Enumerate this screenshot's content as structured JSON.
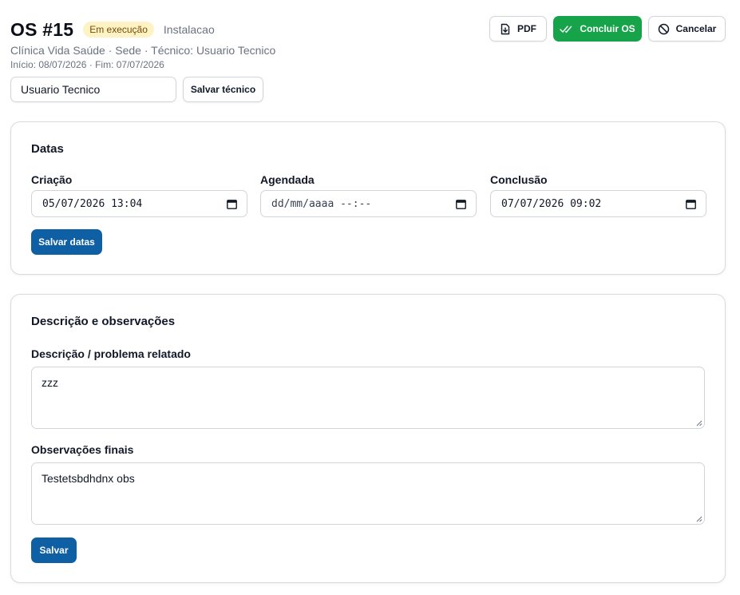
{
  "header": {
    "title": "OS #15",
    "status": "Em execução",
    "type": "Instalacao",
    "subtitle": "Clínica Vida Saúde · Sede · Técnico: Usuario Tecnico",
    "dates": "Início: 08/07/2026 · Fim: 07/07/2026"
  },
  "actions": {
    "pdf": "PDF",
    "concluir": "Concluir OS",
    "cancelar": "Cancelar"
  },
  "technician": {
    "value": "Usuario Tecnico",
    "save": "Salvar técnico"
  },
  "dates_card": {
    "title": "Datas",
    "fields": [
      {
        "label": "Criação",
        "value": "05/07/2026 13:04"
      },
      {
        "label": "Agendada",
        "value": "dd/mm/aaaa --:--"
      },
      {
        "label": "Conclusão",
        "value": "07/07/2026 09:02"
      }
    ],
    "save": "Salvar datas"
  },
  "desc_card": {
    "title": "Descrição e observações",
    "description_label": "Descrição / problema relatado",
    "description_value": "zzz",
    "notes_label": "Observações finais",
    "notes_value": "Testetsbdhdnx obs",
    "save": "Salvar"
  },
  "colors": {
    "status_bg": "#fdf3c4",
    "status_text": "#7a4a07",
    "success": "#16a34a",
    "primary": "#0e5fa3"
  },
  "icons": {
    "pdf": "file-download-icon",
    "concluir": "double-check-icon",
    "cancelar": "ban-icon",
    "date": "calendar-icon"
  }
}
